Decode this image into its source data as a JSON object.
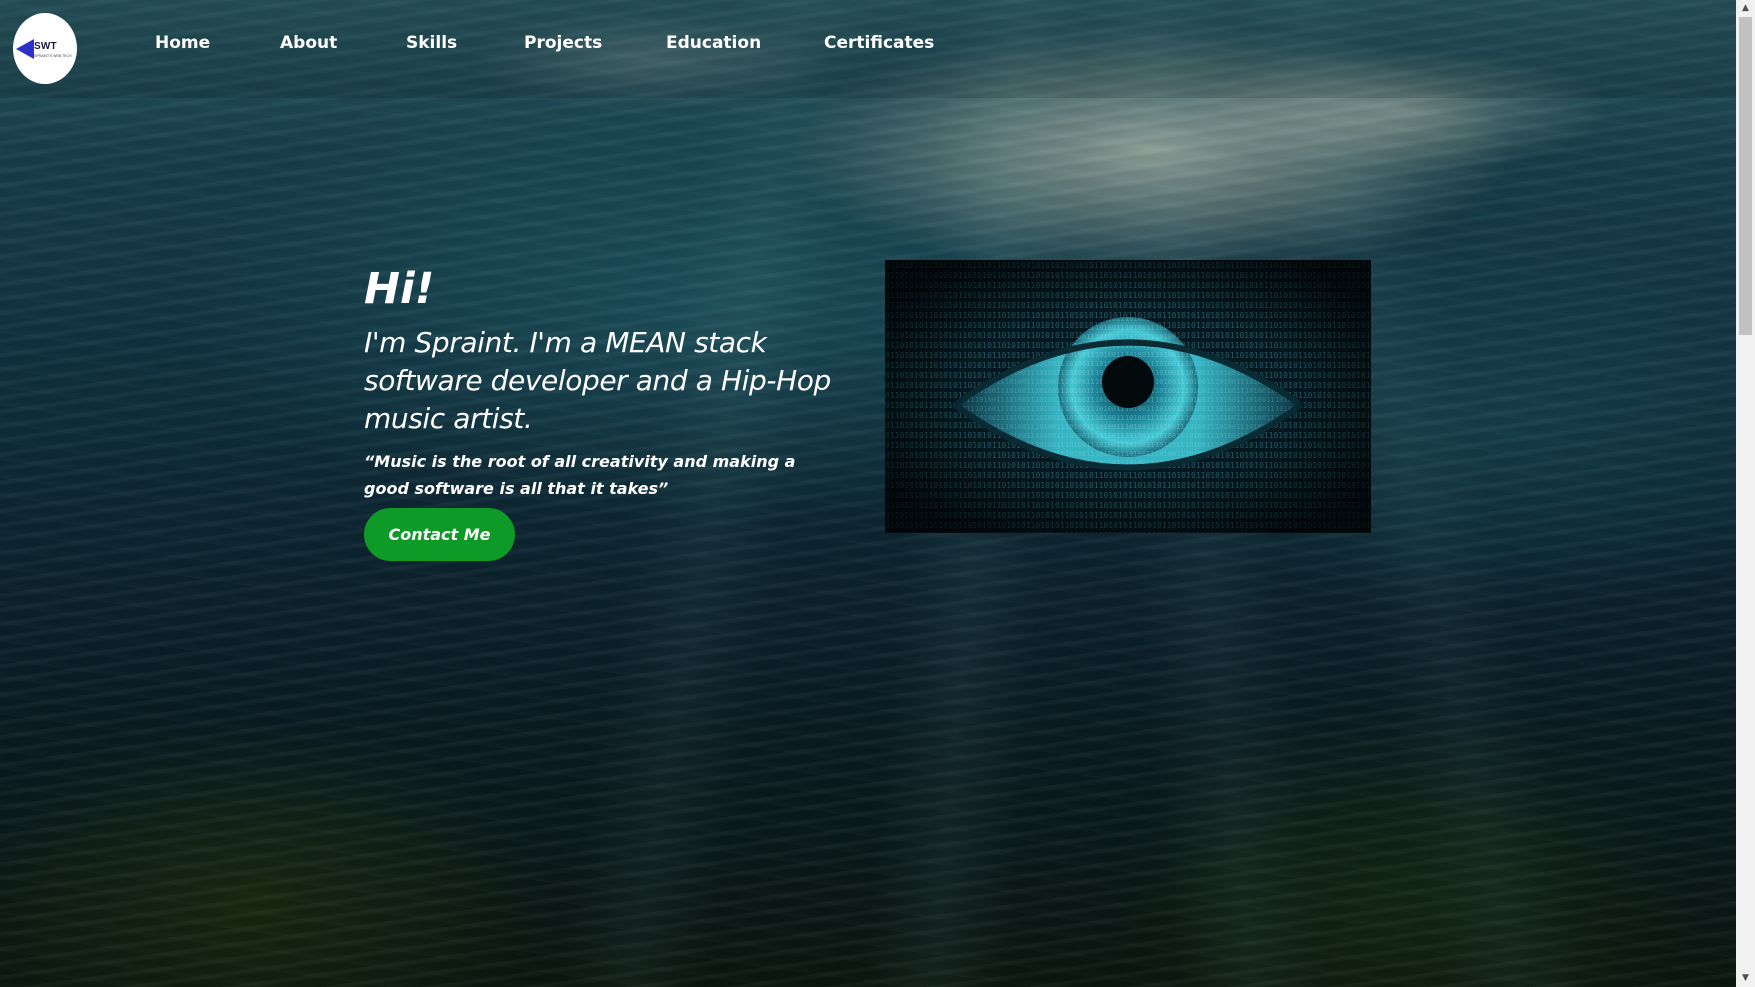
{
  "logo": {
    "text": "SWT",
    "subtext": "SPRAINT'S WEB TECH"
  },
  "nav": {
    "items": [
      {
        "label": "Home"
      },
      {
        "label": "About"
      },
      {
        "label": "Skills"
      },
      {
        "label": "Projects"
      },
      {
        "label": "Education"
      },
      {
        "label": "Certificates"
      }
    ]
  },
  "hero": {
    "greeting": "Hi!",
    "intro": "I'm Spraint. I'm a MEAN stack software developer and a Hip-Hop music artist.",
    "quote": "“Music is the root of all creativity and making a good software is all that it takes”",
    "cta_label": "Contact Me",
    "image_icon": "binary-eye-image"
  },
  "scrollbar": {
    "up_icon": "chevron-up-icon",
    "down_icon": "chevron-down-icon"
  },
  "colors": {
    "cta": "#0e9a26",
    "logo_accent": "#2b31c9",
    "eye": "#34b8c4"
  }
}
